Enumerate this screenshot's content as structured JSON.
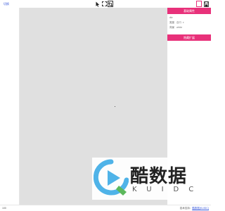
{
  "app": {
    "brand": "切换"
  },
  "toolbar": {
    "tools": [
      {
        "icon": "pointer-icon"
      },
      {
        "icon": "select-frame-icon"
      },
      {
        "icon": "crop-icon",
        "active": true
      }
    ]
  },
  "right_toolbar": {
    "icons": [
      "page-icon",
      "save-icon"
    ]
  },
  "colors": {
    "accent": "#e8317a",
    "canvas": "#e0e0e0",
    "link": "#3b5bdb"
  },
  "panel": {
    "header": "基础属性",
    "rows": [
      {
        "label": "div",
        "value": ""
      },
      {
        "label": "宽度",
        "value": "自行",
        "caret": "▾"
      },
      {
        "label": "背景",
        "value": "white"
      }
    ],
    "footer_header": "隐藏扩展"
  },
  "status": {
    "left": "100",
    "right_prefix": "技术支持：",
    "right_link": "酷数据(KUIDC)"
  },
  "watermark": {
    "name": "酷数据",
    "letters": "KUIDC"
  }
}
